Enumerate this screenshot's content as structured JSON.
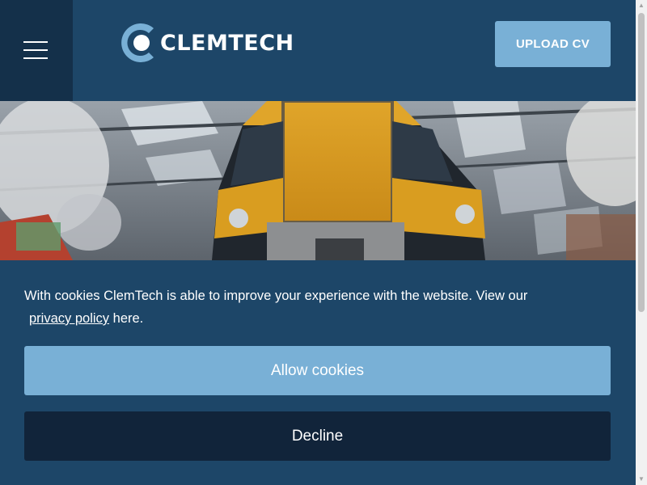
{
  "header": {
    "menu_icon": "hamburger-menu-icon",
    "logo_text": "CLEMTECH",
    "upload_label": "UPLOAD CV"
  },
  "hero": {
    "image": "train-maintenance-workshop-photo"
  },
  "cookie_banner": {
    "message": "With cookies ClemTech is able to improve your experience with the website. View our",
    "link_text": "privacy policy",
    "message_end": "here.",
    "allow_label": "Allow cookies",
    "decline_label": "Decline"
  },
  "colors": {
    "header_bg": "#1d4668",
    "menu_bg": "#14304a",
    "accent": "#79b0d6",
    "decline_bg": "#11243a"
  }
}
